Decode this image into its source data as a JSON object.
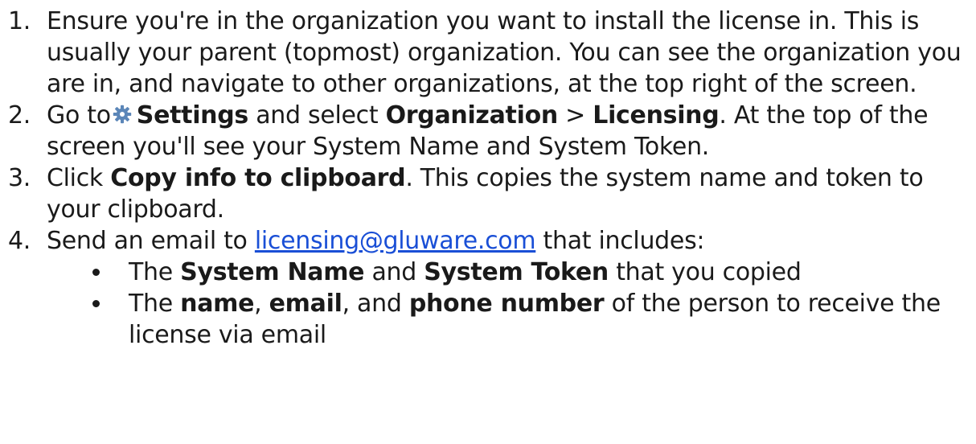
{
  "steps": [
    {
      "num": "1.",
      "parts": [
        {
          "t": "Ensure you're in the organization you want to install the license in. This is usually your parent (topmost) organization. You can see the organization you are in, and navigate to other organizations, at the top right of the screen."
        }
      ]
    },
    {
      "num": "2.",
      "pre": "Go to",
      "settings": "Settings",
      "mid1": " and select ",
      "org": "Organization",
      "mid2": " > ",
      "lic": "Licensing",
      "post": ". At the top of the screen you'll see your System Name and System Token."
    },
    {
      "num": "3.",
      "pre": "Click ",
      "copy": "Copy info to clipboard",
      "post": ". This copies the system name and token to your clipboard."
    },
    {
      "num": "4.",
      "pre": "Send an email to ",
      "email": "licensing@gluware.com",
      "post": " that includes:",
      "sub": [
        {
          "the": "The ",
          "b1": "System Name",
          "and": " and ",
          "b2": "System Token",
          "post": " that you copied"
        },
        {
          "the": "The ",
          "b1": "name",
          "c1": ", ",
          "b2": "email",
          "c2": ", and ",
          "b3": "phone number",
          "post": " of the person to receive the license via email"
        }
      ]
    }
  ],
  "icons": {
    "settings": "gear-icon",
    "gear_color": "#5b86b8"
  },
  "colors": {
    "link": "#1a4fd6",
    "text": "#1a1a1a"
  }
}
